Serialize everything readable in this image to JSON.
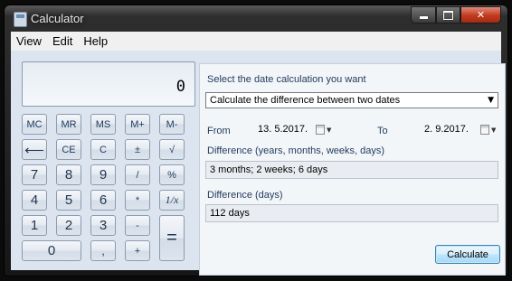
{
  "window": {
    "title": "Calculator"
  },
  "menu": [
    "View",
    "Edit",
    "Help"
  ],
  "display": {
    "value": "0"
  },
  "keys": {
    "mc": "MC",
    "mr": "MR",
    "ms": "MS",
    "mplus": "M+",
    "mminus": "M-",
    "backspace": "⟵",
    "ce": "CE",
    "c": "C",
    "plusminus": "±",
    "sqrt": "√",
    "seven": "7",
    "eight": "8",
    "nine": "9",
    "divide": "/",
    "percent": "%",
    "four": "4",
    "five": "5",
    "six": "6",
    "multiply": "*",
    "reciprocal": "1/x",
    "one": "1",
    "two": "2",
    "three": "3",
    "minus": "-",
    "equals": "=",
    "zero": "0",
    "decimal": ",",
    "plus": "+"
  },
  "date_panel": {
    "prompt": "Select the date calculation you want",
    "mode": "Calculate the difference between two dates",
    "from_label": "From",
    "from_date": "13.  5.2017.",
    "to_label": "To",
    "to_date": "2.  9.2017.",
    "diff_label": "Difference (years, months, weeks, days)",
    "diff_value": "3 months; 2 weeks; 6 days",
    "days_label": "Difference (days)",
    "days_value": "112 days",
    "calculate_label": "Calculate"
  },
  "icons": {
    "app": "calculator-icon",
    "minimize": "minimize-icon",
    "maximize": "maximize-icon",
    "close": "close-icon",
    "calendar": "calendar-icon",
    "dropdown": "chevron-down-icon"
  },
  "colors": {
    "panel_bg": "#dbe4ef",
    "key_text": "#1e395b",
    "accent_button": "#a7d9f5",
    "close_button": "#c23a1f"
  }
}
